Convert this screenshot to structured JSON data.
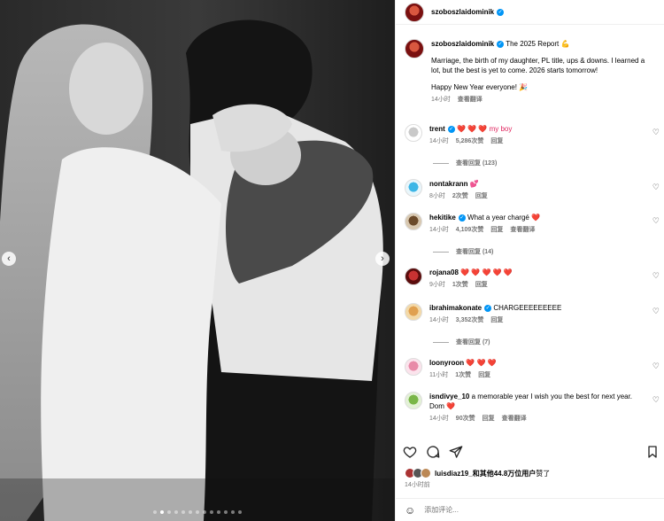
{
  "media": {
    "dots_total": 13,
    "dots_active": 2
  },
  "post": {
    "author": "szoboszlaidominik",
    "title": "The 2025 Report",
    "caption": "Marriage, the birth of my daughter, PL title, ups & downs. I learned a lot, but the best is yet to come. 2026 starts tomorrow!",
    "caption2": "Happy New Year everyone! 🎉",
    "time": "14小时",
    "translate": "查看翻译"
  },
  "comments": [
    {
      "user": "trent",
      "verified": true,
      "text": "❤️ ❤️ ❤️ my boy",
      "time": "14小时",
      "likes": "5,286次赞",
      "reply": "回复",
      "translate": "",
      "replies": "查看回复 (123)"
    },
    {
      "user": "nontakrann",
      "verified": false,
      "text": "💕",
      "time": "8小时",
      "likes": "2次赞",
      "reply": "回复",
      "translate": "",
      "replies": ""
    },
    {
      "user": "hekitike",
      "verified": true,
      "text": "What a year chargé ❤️",
      "time": "14小时",
      "likes": "4,109次赞",
      "reply": "回复",
      "translate": "查看翻译",
      "replies": "查看回复 (14)"
    },
    {
      "user": "rojana08",
      "verified": false,
      "text": "❤️ ❤️ ❤️ ❤️ ❤️",
      "time": "9小时",
      "likes": "1次赞",
      "reply": "回复",
      "translate": "",
      "replies": ""
    },
    {
      "user": "ibrahimakonate",
      "verified": true,
      "text": "CHARGEEEEEEEEE",
      "time": "14小时",
      "likes": "3,352次赞",
      "reply": "回复",
      "translate": "",
      "replies": "查看回复 (7)"
    },
    {
      "user": "loonyroon",
      "verified": false,
      "text": "❤️ ❤️ ❤️",
      "time": "11小时",
      "likes": "1次赞",
      "reply": "回复",
      "translate": "",
      "replies": ""
    },
    {
      "user": "isndivye_10",
      "verified": false,
      "text": "a memorable year I wish you the best for next year. Dom ❤️",
      "time": "14小时",
      "likes": "90次赞",
      "reply": "回复",
      "translate": "查看翻译",
      "replies": ""
    }
  ],
  "likes": {
    "user": "luisdiaz19",
    "rest": "_和其他44.8万位用户",
    "suffix": "赞了"
  },
  "posted_time": "14小时前",
  "add_comment_placeholder": "添加评论...",
  "colors": {
    "heart": "#e0245e",
    "verified": "#0095f6",
    "meta": "#737373"
  }
}
